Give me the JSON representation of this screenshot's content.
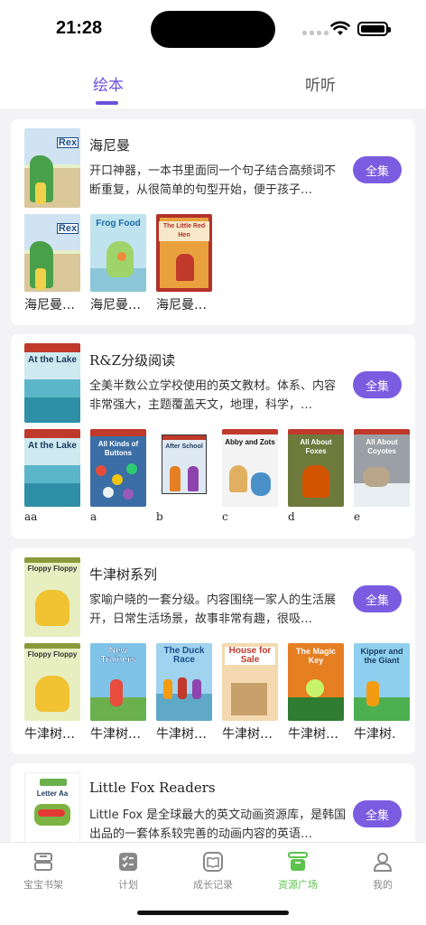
{
  "status": {
    "time": "21:28"
  },
  "tabs": [
    {
      "label": "绘本",
      "active": true
    },
    {
      "label": "听听",
      "active": false
    }
  ],
  "series": [
    {
      "title": "海尼曼",
      "description": "开口神器，一本书里面同一个句子结合高频词不断重复，从很简单的句型开始，便于孩子…",
      "button": "全集",
      "cover_text": "Rex",
      "books": [
        {
          "label": "海尼曼…",
          "cover_text": "Rex"
        },
        {
          "label": "海尼曼…",
          "cover_text": "Frog Food"
        },
        {
          "label": "海尼曼…",
          "cover_text": "The Little Red Hen"
        }
      ]
    },
    {
      "title": "R&Z分级阅读",
      "description": "全美半数公立学校使用的英文教材。体系、内容非常强大，主题覆盖天文，地理，科学，…",
      "button": "全集",
      "cover_text": "At the Lake",
      "books": [
        {
          "label": "aa",
          "cover_text": "At the Lake"
        },
        {
          "label": "a",
          "cover_text": "All Kinds of Buttons"
        },
        {
          "label": "b",
          "cover_text": "After School"
        },
        {
          "label": "c",
          "cover_text": "Abby and Zots"
        },
        {
          "label": "d",
          "cover_text": "All About Foxes"
        },
        {
          "label": "e",
          "cover_text": "All About Coyotes"
        }
      ]
    },
    {
      "title": "牛津树系列",
      "description": "家喻户晓的一套分级。内容围绕一家人的生活展开，日常生活场景，故事非常有趣，很吸…",
      "button": "全集",
      "cover_text": "Floppy Floppy",
      "books": [
        {
          "label": "牛津树…",
          "cover_text": "Floppy Floppy"
        },
        {
          "label": "牛津树…",
          "cover_text": "New Trainers"
        },
        {
          "label": "牛津树…",
          "cover_text": "The Duck Race"
        },
        {
          "label": "牛津树…",
          "cover_text": "House for Sale"
        },
        {
          "label": "牛津树…",
          "cover_text": "The Magic Key"
        },
        {
          "label": "牛津树.",
          "cover_text": "Kipper and the Giant"
        }
      ]
    },
    {
      "title": "Little Fox Readers",
      "description": "Little Fox 是全球最大的英文动画资源库，是韩国出品的一套体系较完善的动画内容的英语…",
      "button": "全集",
      "cover_text": "Letter Aa"
    }
  ],
  "bottom_nav": [
    {
      "label": "宝宝书架",
      "icon": "bookshelf-icon",
      "active": false
    },
    {
      "label": "计划",
      "icon": "checklist-icon",
      "active": false
    },
    {
      "label": "成长记录",
      "icon": "open-book-icon",
      "active": false
    },
    {
      "label": "资源广场",
      "icon": "resource-box-icon",
      "active": true
    },
    {
      "label": "我的",
      "icon": "person-icon",
      "active": false
    }
  ],
  "colors": {
    "accent": "#7b5ce0",
    "tab_active": "#6b4fd8",
    "nav_active": "#5cc34e"
  }
}
